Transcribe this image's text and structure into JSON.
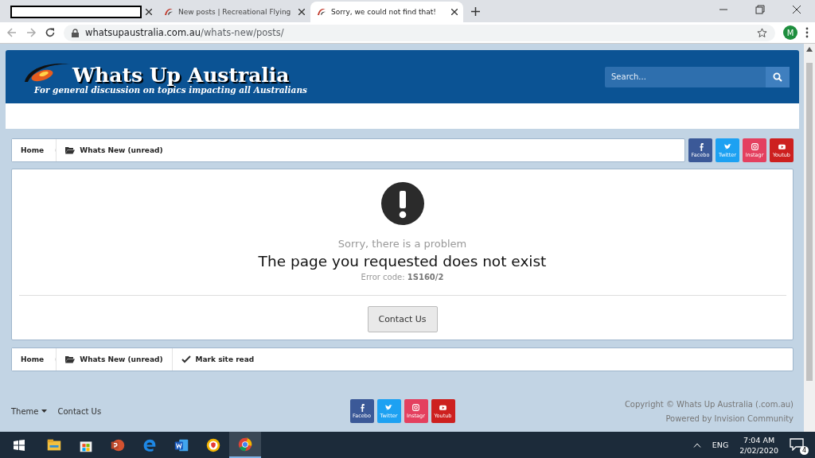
{
  "browser": {
    "tabs": [
      {
        "selected": false
      },
      {
        "title": "New posts | Recreational Flying",
        "selected": false
      },
      {
        "title": "Sorry, we could not find that!",
        "selected": true
      }
    ],
    "url_host": "whatsupaustralia.com.au",
    "url_path": "/whats-new/posts/",
    "profile": "M"
  },
  "header": {
    "title": "Whats Up Australia",
    "tagline": "For general discussion on topics impacting all Australians",
    "search_placeholder": "Search..."
  },
  "breadcrumb_top": {
    "home": "Home",
    "actions": [
      {
        "kind": "folder",
        "label": "Whats New (unread)"
      }
    ],
    "social": [
      {
        "kind": "facebook",
        "label": "Facebo"
      },
      {
        "kind": "twitter",
        "label": "Twitter"
      },
      {
        "kind": "instagram",
        "label": "Instagr"
      },
      {
        "kind": "youtube",
        "label": "Youtub"
      }
    ]
  },
  "error": {
    "subtitle": "Sorry, there is a problem",
    "heading": "The page you requested does not exist",
    "code": "Error code: **1S160/2**",
    "button": "Contact Us"
  },
  "breadcrumb_bottom": {
    "home": "Home",
    "actions": [
      {
        "kind": "folder",
        "label": "Whats New (unread)"
      },
      {
        "kind": "check",
        "label": "Mark site read"
      }
    ]
  },
  "footer": {
    "links": [
      {
        "kind": "dropdown",
        "label": "Theme"
      },
      {
        "kind": "link",
        "label": "Contact Us"
      }
    ],
    "social": [
      {
        "kind": "facebook",
        "label": "Facebo"
      },
      {
        "kind": "twitter",
        "label": "Twitter"
      },
      {
        "kind": "instagram",
        "label": "Instagr"
      },
      {
        "kind": "youtube",
        "label": "Youtub"
      }
    ],
    "copyright": "Copyright © Whats Up Australia (.com.au)",
    "powered": "Powered by Invision Community"
  },
  "taskbar": {
    "apps": [
      {
        "kind": "explorer",
        "selected": false
      },
      {
        "kind": "store",
        "selected": false
      },
      {
        "kind": "powerpoint",
        "selected": false
      },
      {
        "kind": "edge",
        "selected": false
      },
      {
        "kind": "word",
        "selected": false
      },
      {
        "kind": "vpn",
        "selected": false
      },
      {
        "kind": "chrome",
        "selected": true
      }
    ],
    "language": "ENG",
    "time": "7:04 AM",
    "date": "2/02/2020",
    "notifications": "4"
  }
}
